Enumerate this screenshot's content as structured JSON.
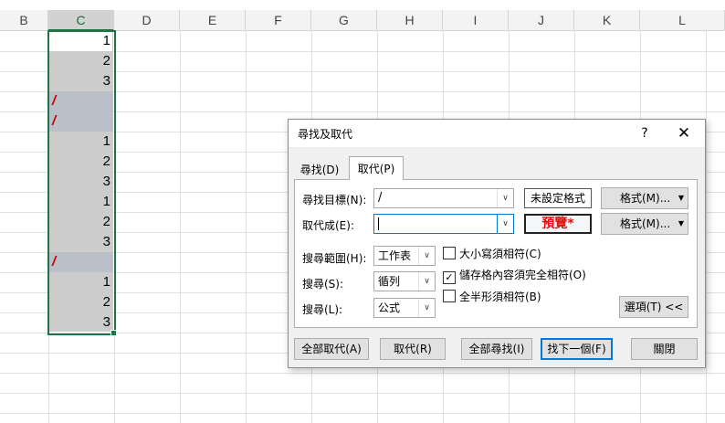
{
  "sheet": {
    "columns": [
      "B",
      "C",
      "D",
      "E",
      "F",
      "G",
      "H",
      "I",
      "J",
      "K",
      "L"
    ],
    "active_column": "C",
    "cells": [
      "1",
      "2",
      "3",
      "/",
      "/",
      "1",
      "2",
      "3",
      "1",
      "2",
      "3",
      "/",
      "1",
      "2",
      "3"
    ]
  },
  "dialog": {
    "title": "尋找及取代",
    "help": "?",
    "close": "✕",
    "tabs": [
      "尋找(D)",
      "取代(P)"
    ],
    "find_label": "尋找目標(N):",
    "find_value": "/",
    "replace_label": "取代成(E):",
    "replace_value": "",
    "find_format_preview": "未設定格式",
    "replace_format_preview": "預覽*",
    "format_button": "格式(M)...",
    "within_label": "搜尋範圍(H):",
    "within_value": "工作表",
    "search_label": "搜尋(S):",
    "search_value": "循列",
    "look_in_label": "搜尋(L):",
    "look_in_value": "公式",
    "match_case": "大小寫須相符(C)",
    "match_case_checked": false,
    "match_entire": "儲存格內容須完全相符(O)",
    "match_entire_checked": true,
    "match_byte": "全半形須相符(B)",
    "match_byte_checked": false,
    "options_button": "選項(T) <<",
    "replace_all_button": "全部取代(A)",
    "replace_button": "取代(R)",
    "find_all_button": "全部尋找(I)",
    "find_next_button": "找下一個(F)",
    "close_button": "關閉"
  }
}
